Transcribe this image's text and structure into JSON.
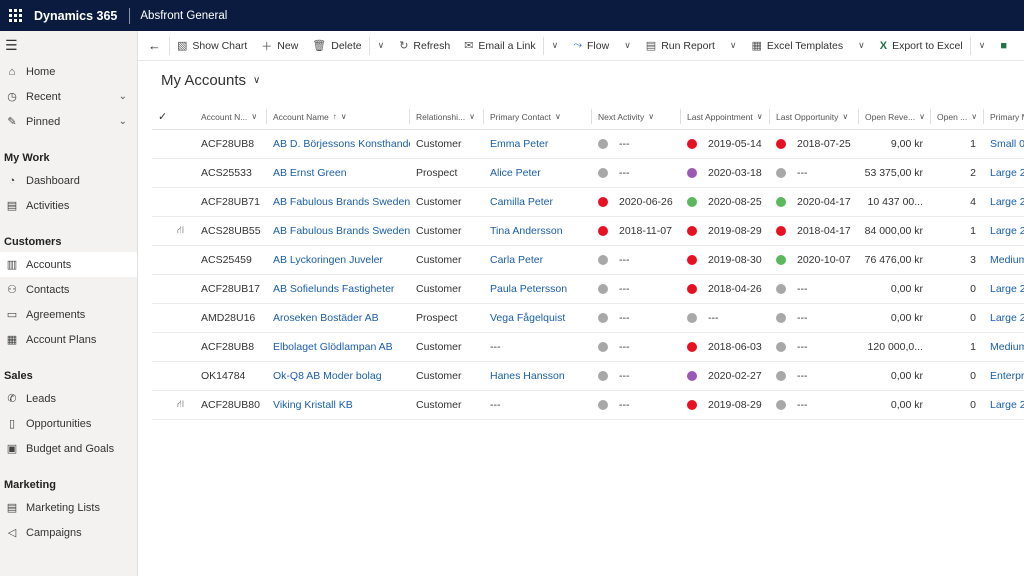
{
  "topbar": {
    "app_name": "Dynamics 365",
    "environment": "Absfront General"
  },
  "sidebar": {
    "home": "Home",
    "recent": "Recent",
    "pinned": "Pinned",
    "section_mywork": "My Work",
    "dashboard": "Dashboard",
    "activities": "Activities",
    "section_customers": "Customers",
    "accounts": "Accounts",
    "contacts": "Contacts",
    "agreements": "Agreements",
    "account_plans": "Account Plans",
    "section_sales": "Sales",
    "leads": "Leads",
    "opportunities": "Opportunities",
    "budget_goals": "Budget and Goals",
    "section_marketing": "Marketing",
    "marketing_lists": "Marketing Lists",
    "campaigns": "Campaigns"
  },
  "commands": {
    "show_chart": "Show Chart",
    "new": "New",
    "delete": "Delete",
    "refresh": "Refresh",
    "email_link": "Email a Link",
    "flow": "Flow",
    "run_report": "Run Report",
    "excel_templates": "Excel Templates",
    "export_excel": "Export to Excel"
  },
  "view": {
    "title": "My Accounts"
  },
  "columns": {
    "account_number": "Account N...",
    "account_name": "Account Name",
    "relationship": "Relationshi...",
    "primary_contact": "Primary Contact",
    "next_activity": "Next Activity",
    "last_appointment": "Last Appointment",
    "last_opportunity": "Last Opportunity",
    "open_revenue": "Open Reve...",
    "open_count": "Open ...",
    "primary_m": "Primary M"
  },
  "colors": {
    "red": "#e81123",
    "grey": "#a8a8a8",
    "green": "#5cb85c",
    "purple": "#9b59b6",
    "link": "#1a5ea8"
  },
  "rows": [
    {
      "hier": false,
      "num": "ACF28UB8",
      "name": "AB D. Börjessons Konsthandel...",
      "rel": "Customer",
      "contact": "Emma Peter",
      "next_c": "#a8a8a8",
      "next": "---",
      "appt_c": "#e81123",
      "appt": "2019-05-14",
      "opp_c": "#e81123",
      "opp": "2018-07-25",
      "rev": "9,00 kr",
      "cnt": "1",
      "pm": "Small 0"
    },
    {
      "hier": false,
      "num": "ACS25533",
      "name": "AB Ernst Green",
      "rel": "Prospect",
      "contact": "Alice Peter",
      "next_c": "#a8a8a8",
      "next": "---",
      "appt_c": "#9b59b6",
      "appt": "2020-03-18",
      "opp_c": "#a8a8a8",
      "opp": "---",
      "rev": "53 375,00 kr",
      "cnt": "2",
      "pm": "Large 2"
    },
    {
      "hier": false,
      "num": "ACF28UB71",
      "name": "AB Fabulous Brands Sweden",
      "rel": "Customer",
      "contact": "Camilla Peter",
      "next_c": "#e81123",
      "next": "2020-06-26",
      "appt_c": "#5cb85c",
      "appt": "2020-08-25",
      "opp_c": "#5cb85c",
      "opp": "2020-04-17",
      "rev": "10 437 00...",
      "cnt": "4",
      "pm": "Large 2"
    },
    {
      "hier": true,
      "num": "ACS28UB55",
      "name": "AB Fabulous Brands Sweden Fo",
      "rel": "Customer",
      "contact": "Tina Andersson",
      "next_c": "#e81123",
      "next": "2018-11-07",
      "appt_c": "#e81123",
      "appt": "2019-08-29",
      "opp_c": "#e81123",
      "opp": "2018-04-17",
      "rev": "84 000,00 kr",
      "cnt": "1",
      "pm": "Large 2"
    },
    {
      "hier": false,
      "num": "ACS25459",
      "name": "AB Lyckoringen Juveler",
      "rel": "Customer",
      "contact": "Carla Peter",
      "next_c": "#a8a8a8",
      "next": "---",
      "appt_c": "#e81123",
      "appt": "2019-08-30",
      "opp_c": "#5cb85c",
      "opp": "2020-10-07",
      "rev": "76 476,00 kr",
      "cnt": "3",
      "pm": "Medium"
    },
    {
      "hier": false,
      "num": "ACF28UB17",
      "name": "AB Sofielunds Fastigheter",
      "rel": "Customer",
      "contact": "Paula Petersson",
      "next_c": "#a8a8a8",
      "next": "---",
      "appt_c": "#e81123",
      "appt": "2018-04-26",
      "opp_c": "#a8a8a8",
      "opp": "---",
      "rev": "0,00 kr",
      "cnt": "0",
      "pm": "Large 2"
    },
    {
      "hier": false,
      "num": "AMD28U16",
      "name": "Aroseken Bostäder AB",
      "rel": "Prospect",
      "contact": "Vega Fågelquist",
      "next_c": "#a8a8a8",
      "next": "---",
      "appt_c": "#a8a8a8",
      "appt": "---",
      "opp_c": "#a8a8a8",
      "opp": "---",
      "rev": "0,00 kr",
      "cnt": "0",
      "pm": "Large 2"
    },
    {
      "hier": false,
      "num": "ACF28UB8",
      "name": "Elbolaget Glödlampan AB",
      "rel": "Customer",
      "contact": "---",
      "contact_plain": true,
      "next_c": "#a8a8a8",
      "next": "---",
      "appt_c": "#e81123",
      "appt": "2018-06-03",
      "opp_c": "#a8a8a8",
      "opp": "---",
      "rev": "120 000,0...",
      "cnt": "1",
      "pm": "Medium"
    },
    {
      "hier": false,
      "num": "OK14784",
      "name": "Ok-Q8 AB Moder bolag",
      "rel": "Customer",
      "contact": "Hanes Hansson",
      "next_c": "#a8a8a8",
      "next": "---",
      "appt_c": "#9b59b6",
      "appt": "2020-02-27",
      "opp_c": "#a8a8a8",
      "opp": "---",
      "rev": "0,00 kr",
      "cnt": "0",
      "pm": "Enterpri"
    },
    {
      "hier": true,
      "num": "ACF28UB80",
      "name": "Viking Kristall KB",
      "rel": "Customer",
      "contact": "---",
      "contact_plain": true,
      "next_c": "#a8a8a8",
      "next": "---",
      "appt_c": "#e81123",
      "appt": "2019-08-29",
      "opp_c": "#a8a8a8",
      "opp": "---",
      "rev": "0,00 kr",
      "cnt": "0",
      "pm": "Large 2"
    }
  ]
}
